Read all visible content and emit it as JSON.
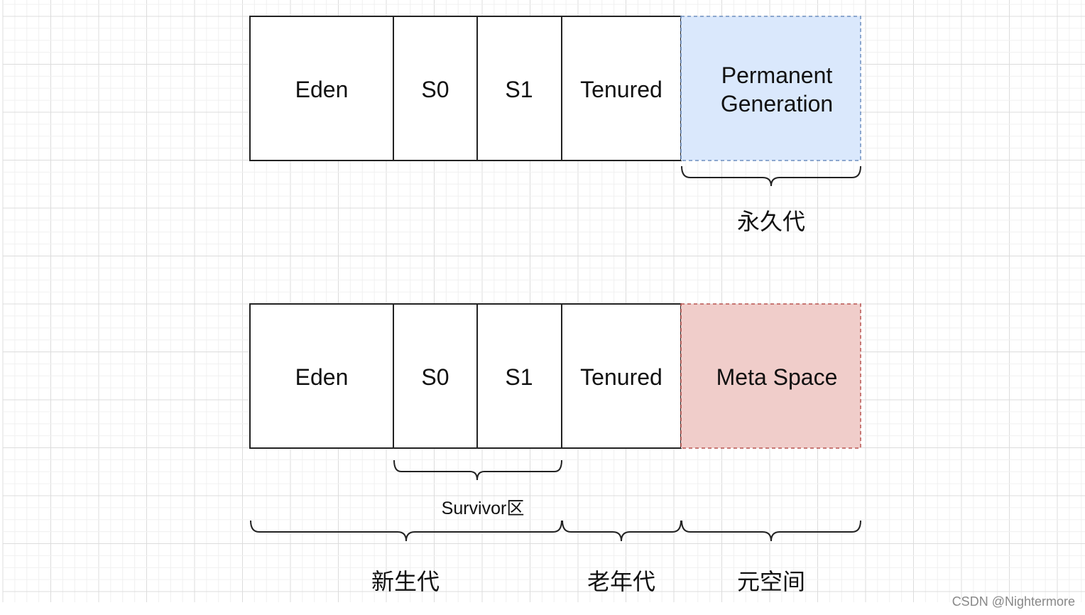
{
  "top_row": {
    "eden": "Eden",
    "s0": "S0",
    "s1": "S1",
    "tenured": "Tenured",
    "permgen_line1": "Permanent",
    "permgen_line2": "Generation",
    "permgen_brace_label": "永久代"
  },
  "bottom_row": {
    "eden": "Eden",
    "s0": "S0",
    "s1": "S1",
    "tenured": "Tenured",
    "metaspace": "Meta Space",
    "survivor_label": "Survivor区",
    "young_label": "新生代",
    "old_label": "老年代",
    "meta_label": "元空间"
  },
  "colors": {
    "permgen_fill": "#dae8fc",
    "permgen_stroke": "#6c8ebf",
    "metaspace_fill": "#f0cdca",
    "metaspace_stroke": "#b85450"
  },
  "watermark": "CSDN @Nightermore"
}
